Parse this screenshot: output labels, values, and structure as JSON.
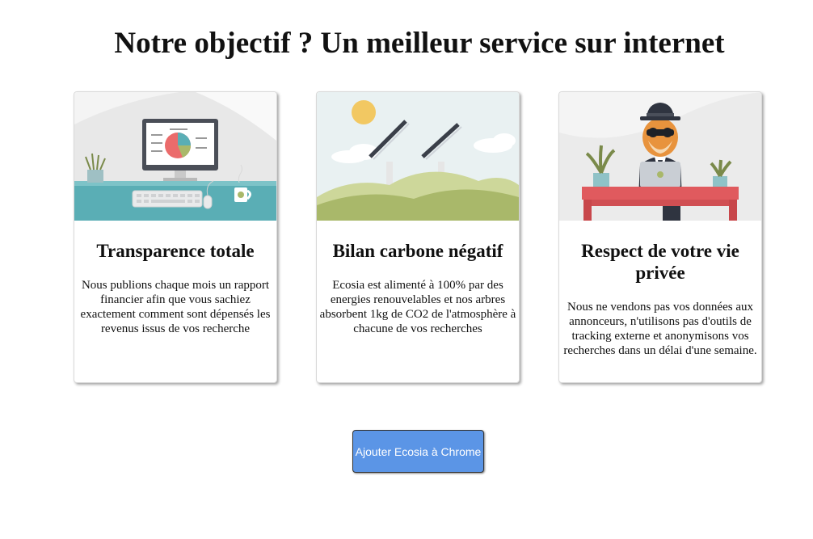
{
  "page": {
    "title": "Notre objectif ? Un meilleur service sur internet"
  },
  "cards": [
    {
      "illustration": "computer-dashboard-illustration",
      "title": "Transparence totale",
      "text": "Nous publions chaque mois un rapport financier afin que vous sachiez exactement comment sont dépensés les revenus issus de vos recherche"
    },
    {
      "illustration": "solar-panels-illustration",
      "title": "Bilan carbone négatif",
      "text": "Ecosia est alimenté à 100% par des energies renouvelables et nos arbres absorbent 1kg de CO2 de l'atmosphère à chacune de vos recherches"
    },
    {
      "illustration": "incognito-tiger-illustration",
      "title": "Respect de votre vie privée",
      "text": "Nous ne vendons pas vos données aux annonceurs, n'utilisons pas d'outils de tracking externe et anonymisons vos recherches dans un délai d'une semaine."
    }
  ],
  "cta": {
    "label": "Ajouter Ecosia à Chrome"
  },
  "colors": {
    "button": "#5b95e6",
    "desk_teal": "#5aaeb5",
    "hill_green": "#a9b86a",
    "desk_red": "#e05a5e"
  }
}
